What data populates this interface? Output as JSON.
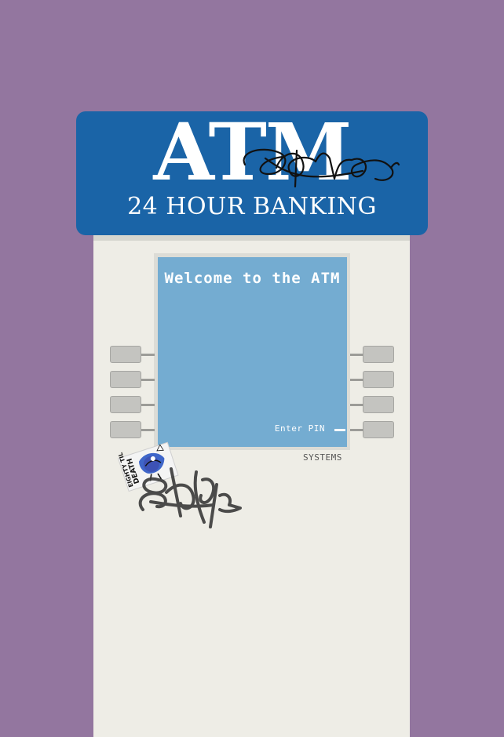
{
  "sign": {
    "title": "ATM",
    "subtitle": "24 HOUR BANKING"
  },
  "screen": {
    "welcome": "Welcome to the ATM",
    "pin_label": "Enter PIN"
  },
  "brand": {
    "label": "SYSTEMS"
  },
  "sticker": {
    "text": "EIGHTY TIL DEATH"
  },
  "colors": {
    "background": "#93769f",
    "sign": "#1a64a7",
    "panel": "#eeede6",
    "screen": "#74acd1",
    "key": "#c4c4c0"
  },
  "icons": {
    "graffiti_sign": "graffiti-tag-icon",
    "graffiti_body": "graffiti-tag-icon",
    "sticker": "sticker-icon"
  }
}
